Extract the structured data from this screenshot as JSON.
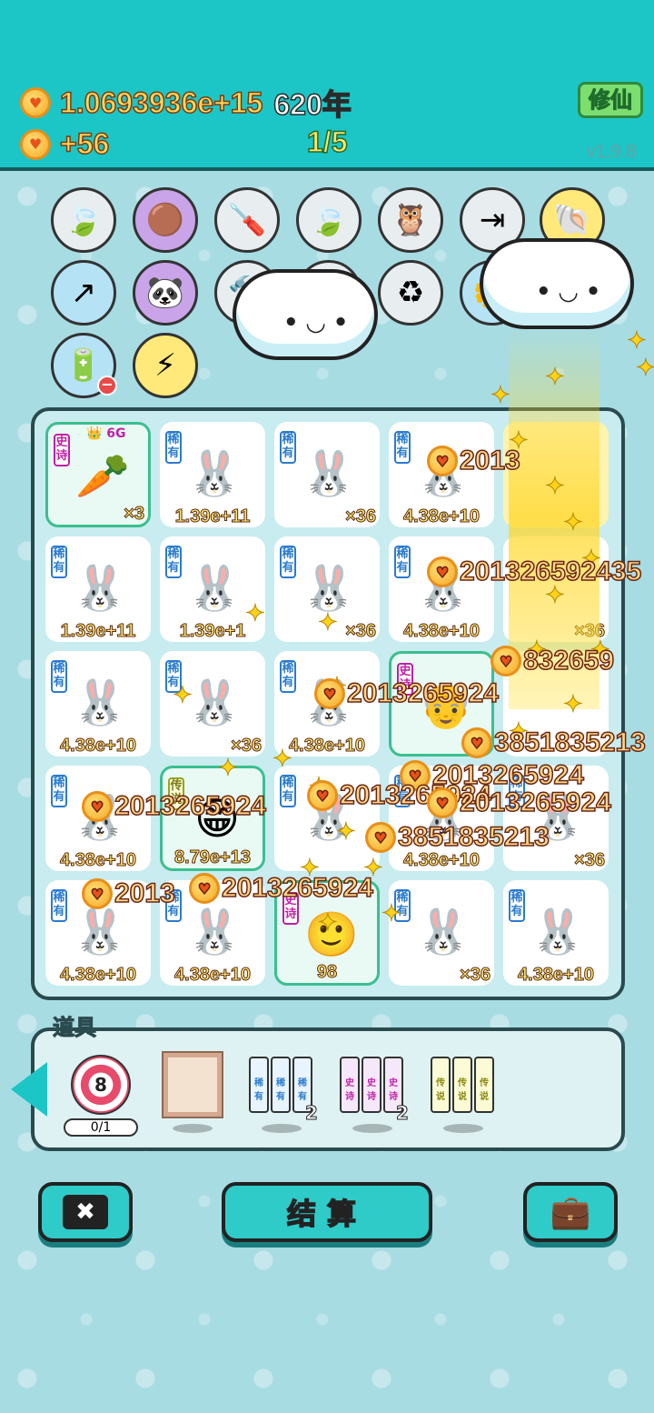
{
  "header": {
    "coins": "1.0693936e+15",
    "years": "620年",
    "income": "+56",
    "stage": "1/5",
    "xiuxian_label": "修仙",
    "version": "v1.9.8"
  },
  "skills": [
    {
      "icon": "leaf-icon",
      "glyph": "🍃"
    },
    {
      "icon": "ball-icon",
      "glyph": "🟤"
    },
    {
      "icon": "screwdriver-icon",
      "glyph": "🪛"
    },
    {
      "icon": "leaf-icon",
      "glyph": "🍃"
    },
    {
      "icon": "owl-icon",
      "glyph": "🦉"
    },
    {
      "icon": "skip-icon",
      "glyph": "⇥"
    },
    {
      "icon": "shell-icon",
      "glyph": "🐚"
    },
    {
      "icon": "arrow-icon",
      "glyph": "↗"
    },
    {
      "icon": "panda-icon",
      "glyph": "🐼"
    },
    {
      "icon": "hammer-icon",
      "glyph": "🔨"
    },
    {
      "icon": "chick-icon",
      "glyph": "🐣"
    },
    {
      "icon": "recycle-icon",
      "glyph": "♻"
    },
    {
      "icon": "flower-pot-icon",
      "glyph": "🌼"
    },
    {
      "icon": "battery-icon",
      "glyph": "🔋"
    },
    {
      "icon": "lightning-icon",
      "glyph": "⚡"
    }
  ],
  "grid": [
    [
      {
        "tag": "史诗",
        "tag_type": "epic",
        "art": "🥕",
        "count": "×3",
        "special": true,
        "crown": "6G"
      },
      {
        "tag": "稀有",
        "tag_type": "rare",
        "art": "🐰",
        "count": "1.39e+11"
      },
      {
        "tag": "稀有",
        "tag_type": "rare",
        "art": "🐰",
        "count": "×36"
      },
      {
        "tag": "稀有",
        "tag_type": "rare",
        "art": "🐰",
        "count": "4.38e+10"
      },
      {
        "tag": "",
        "tag_type": "rare",
        "art": "",
        "count": ""
      }
    ],
    [
      {
        "tag": "稀有",
        "tag_type": "rare",
        "art": "🐰",
        "count": "1.39e+11"
      },
      {
        "tag": "稀有",
        "tag_type": "rare",
        "art": "🐰",
        "count": "1.39e+1"
      },
      {
        "tag": "稀有",
        "tag_type": "rare",
        "art": "🐰",
        "count": "×36"
      },
      {
        "tag": "稀有",
        "tag_type": "rare",
        "art": "🐰",
        "count": "4.38e+10"
      },
      {
        "tag": "",
        "tag_type": "rare",
        "art": "",
        "count": "×36"
      }
    ],
    [
      {
        "tag": "稀有",
        "tag_type": "rare",
        "art": "🐰",
        "count": "4.38e+10"
      },
      {
        "tag": "稀有",
        "tag_type": "rare",
        "art": "🐰",
        "count": "×36"
      },
      {
        "tag": "稀有",
        "tag_type": "rare",
        "art": "🐰",
        "count": "4.38e+10"
      },
      {
        "tag": "史诗",
        "tag_type": "epic",
        "art": "👴",
        "count": "",
        "special": true
      },
      {
        "tag": "",
        "tag_type": "rare",
        "art": "",
        "count": ""
      }
    ],
    [
      {
        "tag": "稀有",
        "tag_type": "rare",
        "art": "🐰",
        "count": "4.38e+10"
      },
      {
        "tag": "传说",
        "tag_type": "legend",
        "art": "😁",
        "count": "8.79e+13",
        "special": true
      },
      {
        "tag": "稀有",
        "tag_type": "rare",
        "art": "🐰",
        "count": ""
      },
      {
        "tag": "稀有",
        "tag_type": "rare",
        "art": "🐰",
        "count": "4.38e+10"
      },
      {
        "tag": "稀有",
        "tag_type": "rare",
        "art": "🐰",
        "count": "×36"
      }
    ],
    [
      {
        "tag": "稀有",
        "tag_type": "rare",
        "art": "🐰",
        "count": "4.38e+10"
      },
      {
        "tag": "稀有",
        "tag_type": "rare",
        "art": "🐰",
        "count": "4.38e+10"
      },
      {
        "tag": "史诗",
        "tag_type": "epic",
        "art": "🙂",
        "count": "98",
        "special": true
      },
      {
        "tag": "稀有",
        "tag_type": "rare",
        "art": "🐰",
        "count": "×36"
      },
      {
        "tag": "稀有",
        "tag_type": "rare",
        "art": "🐰",
        "count": "4.38e+10"
      }
    ]
  ],
  "floats": [
    {
      "text": "2013"
    },
    {
      "text": "201326592435"
    },
    {
      "text": "832659"
    },
    {
      "text": "2013265924"
    },
    {
      "text": "3851835213"
    },
    {
      "text": "2013265924"
    },
    {
      "text": "2013265924"
    },
    {
      "text": "2013265924"
    },
    {
      "text": "2013265924"
    },
    {
      "text": "3851835213"
    },
    {
      "text": "2013"
    },
    {
      "text": "2013265924"
    }
  ],
  "items_panel": {
    "label": "道具",
    "target_value": "8",
    "target_count": "0/1",
    "tools": [
      {
        "type": "rare",
        "cards": [
          "稀有",
          "稀有",
          "稀有"
        ],
        "qty": "2"
      },
      {
        "type": "epic",
        "cards": [
          "史诗",
          "史诗",
          "史诗"
        ],
        "qty": "2"
      },
      {
        "type": "legend",
        "cards": [
          "传说",
          "传说",
          "传说"
        ],
        "qty": ""
      }
    ]
  },
  "bottom": {
    "close_glyph": "✖",
    "settle_label": "结算",
    "bag_glyph": "💼"
  }
}
